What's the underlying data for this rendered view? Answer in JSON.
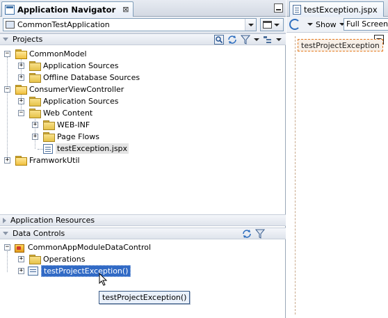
{
  "left_panel": {
    "tab_title": "Application Navigator",
    "close_glyph": "⊠",
    "application_combo": "CommonTestApplication",
    "sections": {
      "projects": "Projects",
      "application_resources": "Application Resources",
      "data_controls": "Data Controls"
    },
    "projects_tree": [
      {
        "label": "CommonModel"
      },
      {
        "label": "Application Sources"
      },
      {
        "label": "Offline Database Sources"
      },
      {
        "label": "ConsumerViewController"
      },
      {
        "label": "Application Sources"
      },
      {
        "label": "Web Content"
      },
      {
        "label": "WEB-INF"
      },
      {
        "label": "Page Flows"
      },
      {
        "label": "testException.jspx"
      },
      {
        "label": "FramworkUtil"
      }
    ],
    "data_controls_tree": [
      {
        "label": "CommonAppModuleDataControl"
      },
      {
        "label": "Operations"
      },
      {
        "label": "testProjectException()"
      }
    ],
    "tooltip": "testProjectException()"
  },
  "right_panel": {
    "tab_title": "testException.jspx",
    "show_label": "Show",
    "view_combo": "Full Screen Size",
    "component_label": "testProjectException"
  },
  "icons": [
    "app-navigator-icon",
    "close-icon",
    "minimize-icon",
    "application-icon",
    "chevron-down-icon",
    "window-icon",
    "search-icon",
    "sync-icon",
    "filter-icon",
    "tree-options-icon",
    "folder-icon",
    "project-icon",
    "page-icon",
    "data-control-icon",
    "method-icon",
    "refresh-icon",
    "mouse-cursor-icon"
  ],
  "colors": {
    "selection_blue": "#316ac5",
    "tab_border": "#7f9db9",
    "component_border": "#e57a1f"
  }
}
